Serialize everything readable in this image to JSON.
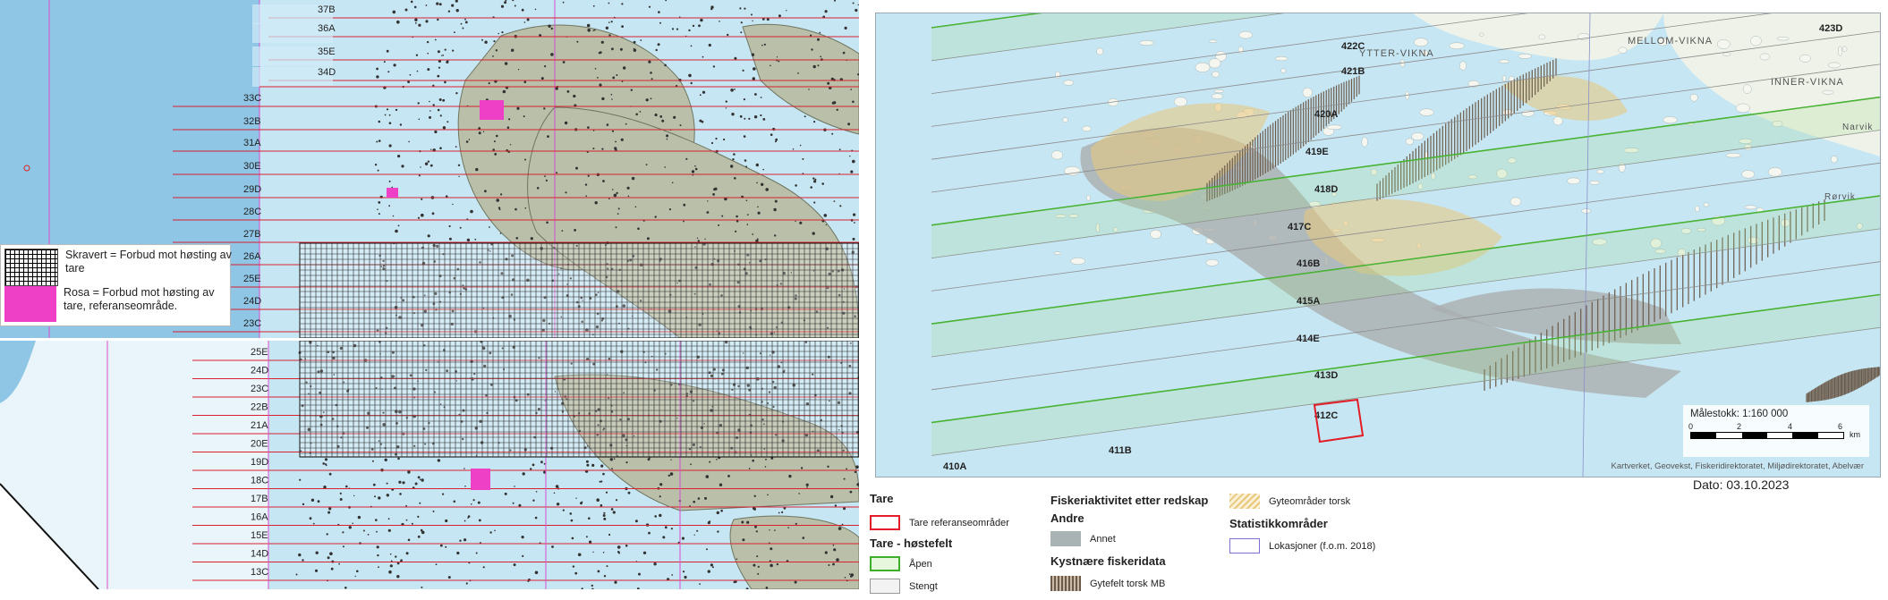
{
  "left_top": {
    "zone_labels": [
      "37B",
      "36A",
      "35E",
      "34D",
      "33C",
      "32B",
      "31A",
      "30E",
      "29D",
      "28C",
      "27B",
      "26A",
      "25E",
      "24D",
      "23C"
    ],
    "legend": {
      "hatched_text": "Skravert = Forbud mot høsting av tare",
      "pink_text": "Rosa = Forbud mot høsting av tare, referanseområde."
    }
  },
  "left_bottom": {
    "zone_labels": [
      "25E",
      "24D",
      "23C",
      "22B",
      "21A",
      "20E",
      "19D",
      "18C",
      "17B",
      "16A",
      "15E",
      "14D",
      "13C"
    ]
  },
  "right_map": {
    "zone_labels": [
      "422C",
      "421B",
      "420A",
      "419E",
      "418D",
      "417C",
      "416B",
      "415A",
      "414E",
      "413D",
      "412C",
      "411B",
      "410A",
      "423D"
    ],
    "place_names": [
      "YTTER-VIKNA",
      "MELLOM-VIKNA",
      "INNER-VIKNA",
      "Narvik",
      "Rørvik"
    ],
    "scale_title": "Målestokk: 1:160 000",
    "scale_ticks": [
      "0",
      "2",
      "4",
      "6"
    ],
    "scale_unit": "km",
    "credits": "Kartverket, Geovekst, Fiskeridirektoratet, Miljødirektoratet, Abelvær"
  },
  "date": "Dato: 03.10.2023",
  "map_legend": {
    "tare_title": "Tare",
    "tare_ref": "Tare referanseområder",
    "hostefelt_title": "Tare - høstefelt",
    "apen": "Åpen",
    "stengt": "Stengt",
    "fiskeri_title": "Fiskeriaktivitet etter redskap",
    "andre_title": "Andre",
    "annet": "Annet",
    "kystnare_title": "Kystnære fiskeridata",
    "gytefelt": "Gytefelt torsk MB",
    "gyteomrader": "Gyteområder torsk",
    "statistikk_title": "Statistikkområder",
    "lokasjoner": "Lokasjoner (f.o.m. 2018)"
  },
  "colors": {
    "sea": "#c7e6f3",
    "land": "#b9bfa8",
    "red_line": "#d8202e",
    "magenta": "#d84fd0",
    "pink_marker": "#ee3fc7",
    "open_green": "#3fae2a",
    "ref_red": "#e21d26"
  }
}
